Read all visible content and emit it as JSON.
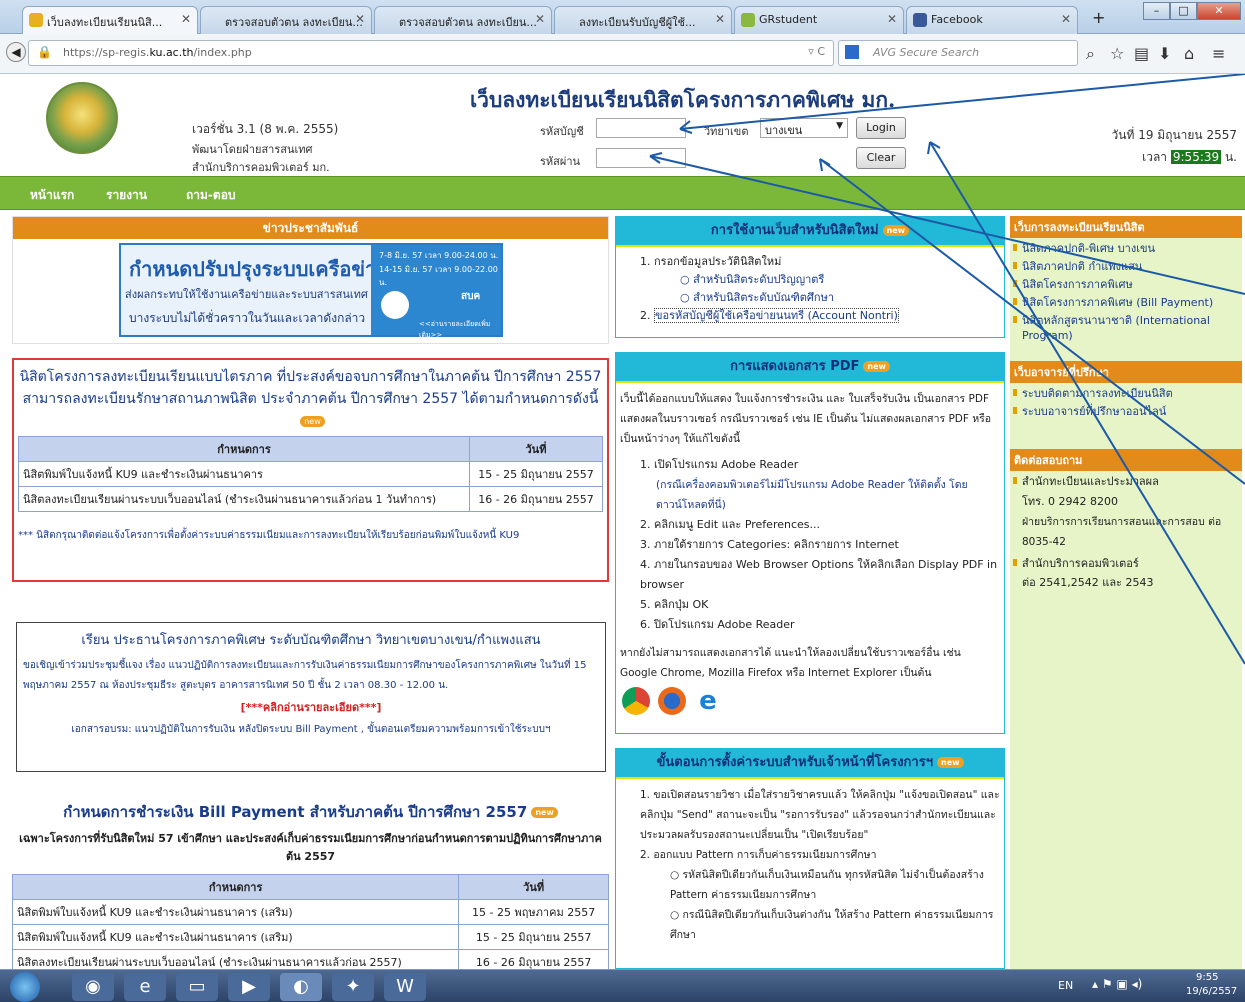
{
  "browser": {
    "tabs": [
      {
        "label": "เว็บลงทะเบียนเรียนนิสิ...",
        "active": true
      },
      {
        "label": "ตรวจสอบตัวตน ลงทะเบียน..."
      },
      {
        "label": "ตรวจสอบตัวตน ลงทะเบียน..."
      },
      {
        "label": "ลงทะเบียนรับบัญชีผู้ใช้..."
      },
      {
        "label": "GRstudent"
      },
      {
        "label": "Facebook"
      }
    ],
    "new_tab": "+",
    "url_prefix": "https://sp-regis.",
    "url_domain": "ku.ac.th",
    "url_path": "/index.php",
    "search_placeholder": "AVG Secure Search"
  },
  "header": {
    "title": "เว็บลงทะเบียนเรียนนิสิตโครงการภาคพิเศษ มก.",
    "version": "เวอร์ชั่น 3.1 (8 พ.ค. 2555)",
    "dev_line1": "พัฒนาโดยฝ่ายสารสนเทศ",
    "dev_line2": "สำนักบริการคอมพิวเตอร์ มก.",
    "account_label": "รหัสบัญชี",
    "password_label": "รหัสผ่าน",
    "campus_label": "วิทยาเขต",
    "campus_value": "บางเขน",
    "login": "Login",
    "clear": "Clear",
    "date": "วันที่ 19 มิถุนายน 2557",
    "time_label": "เวลา",
    "time": "9:55:39",
    "time_unit": "น."
  },
  "menu": [
    "หน้าแรก",
    "รายงาน",
    "ถาม-ตอบ"
  ],
  "news": {
    "title": "ข่าวประชาสัมพันธ์",
    "banner_title": "กำหนดปรับปรุงระบบเครือข่าย",
    "banner_line1": "ส่งผลกระทบให้ใช้งานเครือข่ายและระบบสารสนเทศ",
    "banner_line2": "บางระบบไม่ได้ชั่วคราวในวันและเวลาดังกล่าว",
    "banner_date1": "7-8 มิ.ย. 57 เวลา 9.00-24.00 น.",
    "banner_date2": "14-15 มิ.ย. 57 เวลา 9.00-22.00 น.",
    "banner_org": "สบค",
    "banner_more": "<<อ่านรายละเอียดเพิ่มเติม>>"
  },
  "notice1": {
    "text": "นิสิตโครงการลงทะเบียนเรียนแบบไตรภาค ที่ประสงค์ขอจบการศึกษาในภาคต้น ปีการศึกษา 2557 สามารถลงทะเบียนรักษาสถานภาพนิสิต ประจำภาคต้น ปีการศึกษา 2557 ได้ตามกำหนดการดังนี้",
    "col1": "กำหนดการ",
    "col2": "วันที่",
    "rows": [
      {
        "item": "นิสิตพิมพ์ใบแจ้งหนี้ KU9 และชำระเงินผ่านธนาคาร",
        "date": "15 - 25 มิถุนายน 2557"
      },
      {
        "item": "นิสิตลงทะเบียนเรียนผ่านระบบเว็บออนไลน์ (ชำระเงินผ่านธนาคารแล้วก่อน 1 วันทำการ)",
        "date": "16 - 26 มิถุนายน 2557"
      }
    ],
    "footnote": "*** นิสิตกรุณาติดต่อแจ้งโครงการเพื่อตั้งค่าระบบค่าธรรมเนียมและการลงทะเบียนให้เรียบร้อยก่อนพิมพ์ใบแจ้งหนี้ KU9"
  },
  "notice2": {
    "title": "เรียน ประธานโครงการภาคพิเศษ ระดับบัณฑิตศึกษา วิทยาเขตบางเขน/กำแพงแสน",
    "body": "ขอเชิญเข้าร่วมประชุมชี้แจง เรื่อง แนวปฏิบัติการลงทะเบียนและการรับเงินค่าธรรมเนียมการศึกษาของโครงการภาคพิเศษ ในวันที่ 15 พฤษภาคม 2557 ณ ห้องประชุมธีระ สูตะบุตร อาคารสารนิเทศ 50 ปี ชั้น 2 เวลา 08.30 - 12.00 น.",
    "link": "[***คลิกอ่านรายละเอียด***]",
    "docs": "เอกสารอบรม: แนวปฏิบัติในการรับเงิน หลังปิดระบบ Bill Payment , ขั้นตอนเตรียมความพร้อมการเข้าใช้ระบบฯ"
  },
  "notice3": {
    "title": "กำหนดการชำระเงิน Bill Payment สำหรับภาคต้น ปีการศึกษา 2557",
    "subtitle": "เฉพาะโครงการที่รับนิสิตใหม่ 57 เข้าศึกษา และประสงค์เก็บค่าธรรมเนียมการศึกษาก่อนกำหนดการตามปฏิทินการศึกษาภาคต้น 2557",
    "col1": "กำหนดการ",
    "col2": "วันที่",
    "rows": [
      {
        "item": "นิสิตพิมพ์ใบแจ้งหนี้ KU9 และชำระเงินผ่านธนาคาร (เสริม)",
        "date": "15 - 25 พฤษภาคม 2557"
      },
      {
        "item": "นิสิตพิมพ์ใบแจ้งหนี้ KU9 และชำระเงินผ่านธนาคาร (เสริม)",
        "date": "15 - 25 มิถุนายน 2557"
      },
      {
        "item": "นิสิตลงทะเบียนเรียนผ่านระบบเว็บออนไลน์ (ชำระเงินผ่านธนาคารแล้วก่อน 2557)",
        "date": "16 - 26 มิถุนายน 2557"
      }
    ]
  },
  "newuser": {
    "title": "การใช้งานเว็บสำหรับนิสิตใหม่",
    "item1": "กรอกข้อมูลประวัตินิสิตใหม่",
    "sub1": "สำหรับนิสิตระดับปริญญาตรี",
    "sub2": "สำหรับนิสิตระดับบัณฑิตศึกษา",
    "item2": "ขอรหัสบัญชีผู้ใช้เครือข่ายนนทรี (Account Nontri)"
  },
  "pdf": {
    "title": "การแสดงเอกสาร PDF",
    "intro": "เว็บนี้ได้ออกแบบให้แสดง ใบแจ้งการชำระเงิน และ ใบเสร็จรับเงิน เป็นเอกสาร PDF แสดงผลในบราวเซอร์ กรณีบราวเซอร์ เช่น IE เป็นต้น ไม่แสดงผลเอกสาร PDF หรือเป็นหน้าว่างๆ ให้แก้ไขดังนี้",
    "steps": [
      "เปิดโปรแกรม Adobe Reader",
      "คลิกเมนู Edit และ Preferences...",
      "ภายใต้รายการ Categories: คลิกรายการ Internet",
      "ภายในกรอบของ Web Browser Options ให้คลิกเลือก Display PDF in browser",
      "คลิกปุ่ม OK",
      "ปิดโปรแกรม Adobe Reader"
    ],
    "note1": "(กรณีเครื่องคอมพิวเตอร์ไม่มีโปรแกรม Adobe Reader ให้ติดตั้ง โดยดาวน์โหลดที่นี่)",
    "outro": "หากยังไม่สามารถแสดงเอกสารได้ แนะนำให้ลองเปลี่ยนใช้บราวเซอร์อื่น เช่น Google Chrome, Mozilla Firefox หรือ Internet Explorer เป็นต้น"
  },
  "setup": {
    "title": "ขั้นตอนการตั้งค่าระบบสำหรับเจ้าหน้าที่โครงการฯ",
    "step1": "ขอเปิดสอนรายวิชา เมื่อใส่รายวิชาครบแล้ว ให้คลิกปุ่ม \"แจ้งขอเปิดสอน\" และคลิกปุ่ม \"Send\" สถานะจะเป็น \"รอการรับรอง\" แล้วรอจนกว่าสำนักทะเบียนและประมวลผลรับรองสถานะเปลี่ยนเป็น \"เปิดเรียบร้อย\"",
    "step2": "ออกแบบ Pattern การเก็บค่าธรรมเนียมการศึกษา",
    "sub1": "รหัสนิสิตปีเดียวกันเก็บเงินเหมือนกัน ทุกรหัสนิสิต ไม่จำเป็นต้องสร้าง Pattern ค่าธรรมเนียมการศึกษา",
    "sub2": "กรณีนิสิตปีเดียวกันเก็บเงินต่างกัน ให้สร้าง Pattern ค่าธรรมเนียมการศึกษา"
  },
  "sidebar": {
    "h1": "เว็บการลงทะเบียนเรียนนิสิต",
    "links1": [
      "นิสิตภาคปกติ-พิเศษ บางเขน",
      "นิสิตภาคปกติ กำแพงแสน",
      "นิสิตโครงการภาคพิเศษ",
      "นิสิตโครงการภาคพิเศษ (Bill Payment)",
      "นิสิตหลักสูตรนานาชาติ (International Program)"
    ],
    "h2": "เว็บอาจารย์ที่ปรึกษา",
    "links2": [
      "ระบบติดตามการลงทะเบียนนิสิต",
      "ระบบอาจารย์ที่ปรึกษาออนไลน์"
    ],
    "h3": "ติดต่อสอบถาม",
    "contact1": "สำนักทะเบียนและประมวลผล",
    "contact2": "โทร. 0 2942 8200",
    "contact3": "ฝ่ายบริการการเรียนการสอนและการสอบ ต่อ 8035-42",
    "contact4": "สำนักบริการคอมพิวเตอร์",
    "contact5": "ต่อ 2541,2542 และ 2543"
  },
  "taskbar": {
    "lang": "EN",
    "time": "9:55",
    "date": "19/6/2557"
  }
}
